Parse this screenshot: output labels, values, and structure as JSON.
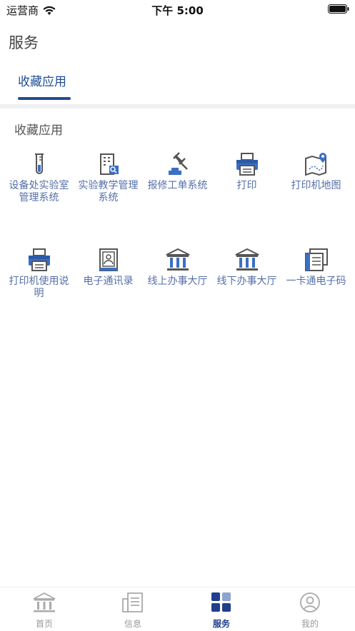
{
  "status_bar": {
    "carrier": "运营商",
    "time": "下午 5:00"
  },
  "page_title": "服务",
  "tab": {
    "label": "收藏应用"
  },
  "section_title": "收藏应用",
  "apps": [
    {
      "label": "设备处实验室管理系统",
      "icon": "test-tube-icon"
    },
    {
      "label": "实验教学管理系统",
      "icon": "building-search-icon"
    },
    {
      "label": "报修工单系统",
      "icon": "gavel-icon"
    },
    {
      "label": "打印",
      "icon": "printer-icon"
    },
    {
      "label": "打印机地图",
      "icon": "map-pin-icon"
    },
    {
      "label": "打印机使用说明",
      "icon": "printer-icon"
    },
    {
      "label": "电子通讯录",
      "icon": "contact-book-icon"
    },
    {
      "label": "线上办事大厅",
      "icon": "hall-icon"
    },
    {
      "label": "线下办事大厅",
      "icon": "hall-icon"
    },
    {
      "label": "一卡通电子码",
      "icon": "card-icon"
    }
  ],
  "bottom_nav": [
    {
      "label": "首页",
      "icon": "home-hall-icon",
      "active": false
    },
    {
      "label": "信息",
      "icon": "info-doc-icon",
      "active": false
    },
    {
      "label": "服务",
      "icon": "grid-icon",
      "active": true
    },
    {
      "label": "我的",
      "icon": "user-icon",
      "active": false
    }
  ],
  "colors": {
    "accent": "#1f4e96",
    "label": "#556fa8",
    "nav_active": "#1f3f8c",
    "nav_inactive": "#999999"
  }
}
